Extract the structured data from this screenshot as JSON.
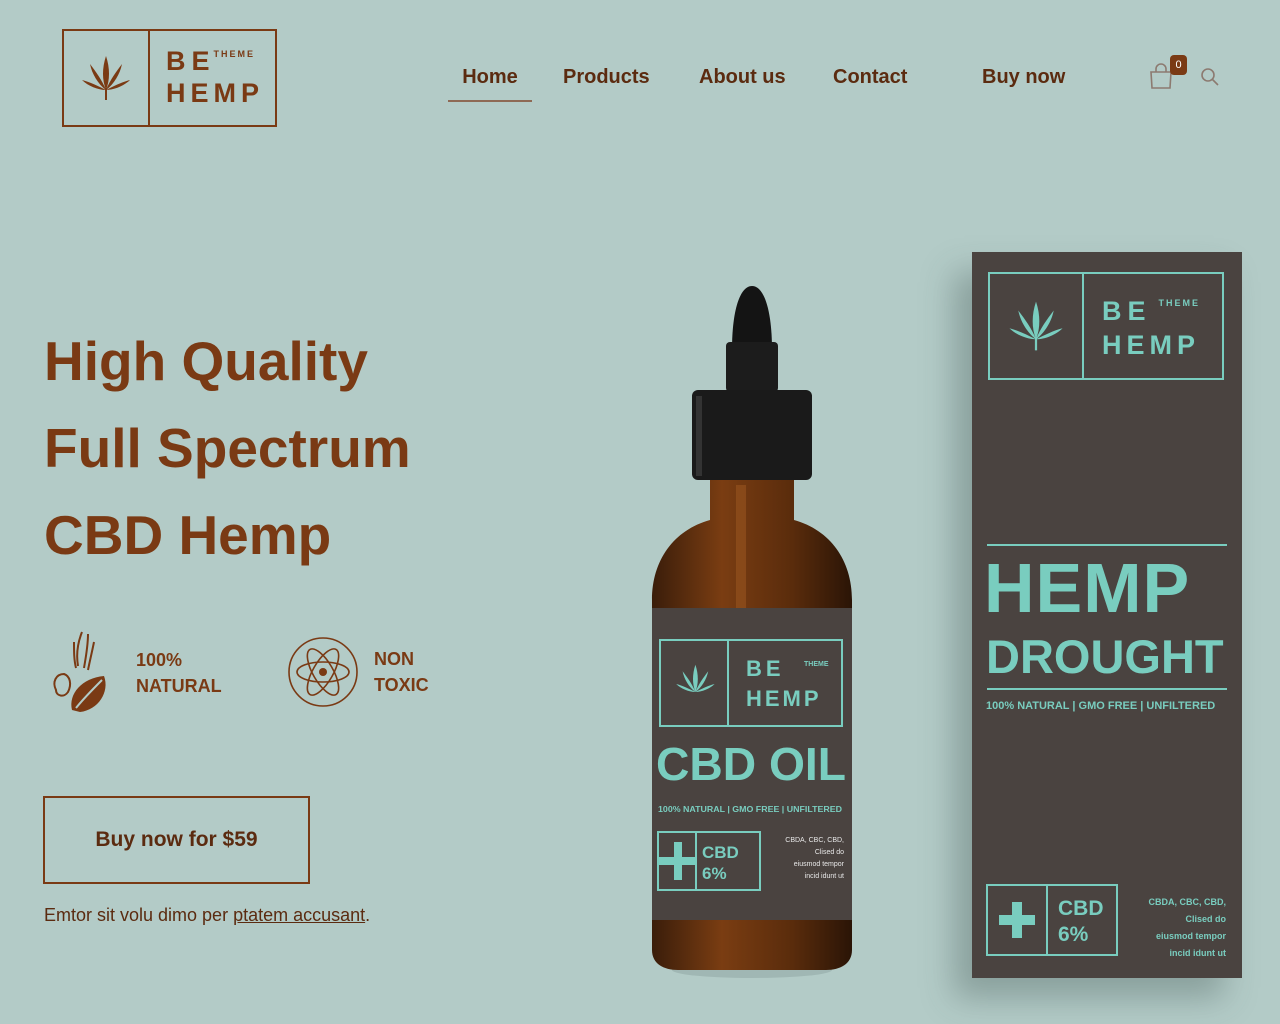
{
  "brand": {
    "line1": "BE",
    "line2": "HEMP",
    "tag": "THEME"
  },
  "nav": {
    "home": "Home",
    "products": "Products",
    "about": "About us",
    "contact": "Contact",
    "buy": "Buy now",
    "cart_count": "0"
  },
  "hero": {
    "line1": "High Quality",
    "line2": "Full Spectrum",
    "line3": "CBD Hemp",
    "features": [
      {
        "line1": "100%",
        "line2": "NATURAL",
        "icon": "hands-leaf-icon"
      },
      {
        "line1": "NON",
        "line2": "TOXIC",
        "icon": "atom-icon"
      }
    ],
    "cta": "Buy now for $59",
    "sub_text": "Emtor sit volu dimo per ",
    "sub_link": "ptatem accusant",
    "sub_end": "."
  },
  "product": {
    "bottle": {
      "logo1": "BE",
      "logo2": "HEMP",
      "logo_tag": "THEME",
      "name": "CBD OIL",
      "tagline": "100% NATURAL | GMO FREE | UNFILTERED",
      "cbd_label": "CBD",
      "cbd_pct": "6%",
      "ingredients": [
        "CBDA, CBC, CBD,",
        "Clised do",
        "eiusmod tempor",
        "incid idunt ut"
      ]
    },
    "box": {
      "logo1": "BE",
      "logo2": "HEMP",
      "logo_tag": "THEME",
      "title1": "HEMP",
      "title2": "DROUGHT",
      "tagline": "100% NATURAL | GMO FREE | UNFILTERED",
      "cbd_label": "CBD",
      "cbd_pct": "6%",
      "ingredients": [
        "CBDA, CBC, CBD,",
        "Clised do",
        "eiusmod tempor",
        "incid idunt ut"
      ]
    }
  },
  "colors": {
    "background": "#b3cbc7",
    "brand": "#7a3a14",
    "package": "#4a4340",
    "package_accent": "#79cdbf"
  }
}
